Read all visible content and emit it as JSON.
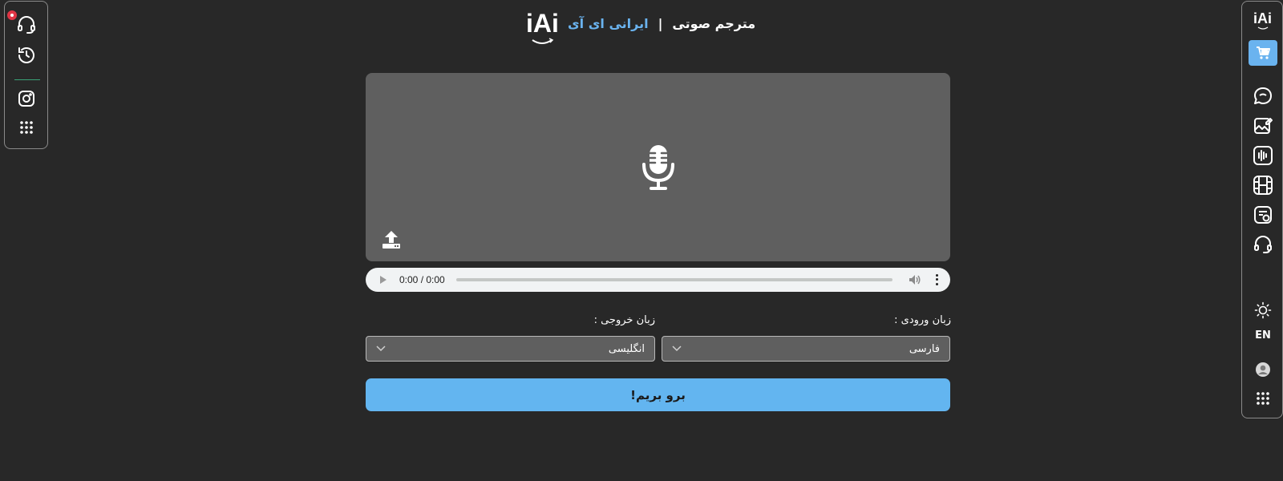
{
  "header": {
    "title": "مترجم صوتی",
    "separator": "|",
    "brand": "ایرانی ای آی",
    "logo_text": "iAi"
  },
  "left_toolbar": {
    "items": [
      {
        "icon": "headset-icon",
        "has_notification": true
      },
      {
        "icon": "history-icon"
      },
      {
        "icon": "instagram-icon"
      },
      {
        "icon": "apps-grid-icon"
      }
    ]
  },
  "right_toolbar": {
    "logo_text": "iAi",
    "items": [
      {
        "icon": "cart-icon",
        "active": true
      },
      {
        "icon": "chat-icon"
      },
      {
        "icon": "image-edit-icon"
      },
      {
        "icon": "audio-wave-icon"
      },
      {
        "icon": "film-icon"
      },
      {
        "icon": "document-translate-icon"
      },
      {
        "icon": "headset-icon"
      },
      {
        "icon": "sun-icon"
      },
      {
        "icon": "user-icon"
      },
      {
        "icon": "apps-grid-icon"
      }
    ],
    "lang_toggle": "EN"
  },
  "recorder": {
    "mic_icon": "microphone-icon",
    "upload_icon": "upload-icon"
  },
  "audio_player": {
    "time": "0:00 / 0:00"
  },
  "languages": {
    "input_label": "زبان ورودی :",
    "input_value": "فارسی",
    "output_label": "زبان خروجی :",
    "output_value": "انگلیسی"
  },
  "go_button": "برو بریم!",
  "colors": {
    "background": "#282828",
    "panel": "#5f5f5f",
    "accent": "#63b5f0",
    "notification": "#e03545"
  }
}
